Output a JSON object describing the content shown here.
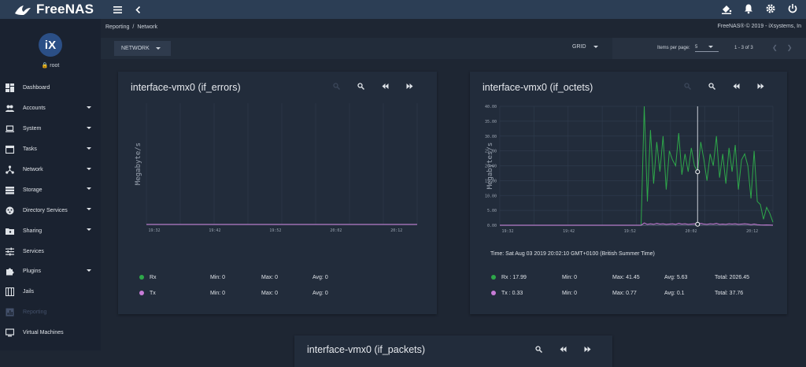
{
  "app": {
    "name": "FreeNAS"
  },
  "topbar": {
    "menu_icon": "hamburger-icon",
    "back_icon": "chevron-left-icon",
    "right_icons": [
      "theme-icon",
      "bell-icon",
      "gear-icon",
      "power-icon"
    ]
  },
  "sidebar": {
    "avatar_text": "iX",
    "user": "root",
    "items": [
      {
        "label": "Dashboard",
        "icon": "dashboard-icon",
        "caret": false
      },
      {
        "label": "Accounts",
        "icon": "accounts-icon",
        "caret": true
      },
      {
        "label": "System",
        "icon": "laptop-icon",
        "caret": true
      },
      {
        "label": "Tasks",
        "icon": "calendar-icon",
        "caret": true
      },
      {
        "label": "Network",
        "icon": "network-icon",
        "caret": true
      },
      {
        "label": "Storage",
        "icon": "storage-icon",
        "caret": true
      },
      {
        "label": "Directory Services",
        "icon": "directory-icon",
        "caret": true
      },
      {
        "label": "Sharing",
        "icon": "folder-share-icon",
        "caret": true
      },
      {
        "label": "Services",
        "icon": "tune-icon",
        "caret": false
      },
      {
        "label": "Plugins",
        "icon": "puzzle-icon",
        "caret": true
      },
      {
        "label": "Jails",
        "icon": "jail-icon",
        "caret": false
      },
      {
        "label": "Reporting",
        "icon": "chart-icon",
        "caret": false
      },
      {
        "label": "Virtual Machines",
        "icon": "monitor-icon",
        "caret": false
      }
    ]
  },
  "breadcrumb": {
    "parent": "Reporting",
    "separator": "/",
    "current": "Network"
  },
  "copyright": "FreeNAS® © 2019 - iXsystems, In",
  "toolbar": {
    "network_label": "NETWORK",
    "grid_label": "GRID",
    "items_per_page_label": "Items per page:",
    "items_per_page_value": "5",
    "range": "1 - 3 of 3"
  },
  "cards": [
    {
      "title": "interface-vmx0 (if_errors)",
      "legend": [
        {
          "name": "Rx",
          "color": "#2ea84a",
          "min": "Min: 0",
          "max": "Max: 0",
          "avg": "Avg: 0"
        },
        {
          "name": "Tx",
          "color": "#c77bd6",
          "min": "Min: 0",
          "max": "Max: 0",
          "avg": "Avg: 0"
        }
      ]
    },
    {
      "title": "interface-vmx0 (if_octets)",
      "time": "Time: Sat Aug 03 2019 20:02:10 GMT+0100 (British Summer Time)",
      "legend": [
        {
          "name": "Rx : 17.99",
          "color": "#2ea84a",
          "min": "Min: 0",
          "max": "Max: 41.45",
          "avg": "Avg: 5.63",
          "total": "Total: 2026.45"
        },
        {
          "name": "Tx : 0.33",
          "color": "#c77bd6",
          "min": "Min: 0",
          "max": "Max: 0.77",
          "avg": "Avg: 0.1",
          "total": "Total: 37.76"
        }
      ]
    },
    {
      "title": "interface-vmx0 (if_packets)"
    }
  ],
  "chart_data": [
    {
      "type": "line",
      "title": "interface-vmx0 (if_errors)",
      "ylabel": "Megabyte/s",
      "x_ticks": [
        "19:32",
        "19:42",
        "19:52",
        "20:02",
        "20:12"
      ],
      "series": [
        {
          "name": "Rx",
          "color": "#2ea84a",
          "values": [
            0,
            0,
            0,
            0,
            0,
            0,
            0
          ]
        },
        {
          "name": "Tx",
          "color": "#c77bd6",
          "values": [
            0,
            0,
            0,
            0,
            0,
            0,
            0
          ]
        }
      ]
    },
    {
      "type": "line",
      "title": "interface-vmx0 (if_octets)",
      "ylabel": "Megabytes/s",
      "ylim": [
        0,
        40
      ],
      "y_ticks": [
        "0.00",
        "5.00",
        "10.00",
        "15.00",
        "20.00",
        "25.00",
        "30.00",
        "35.00",
        "40.00"
      ],
      "x_ticks": [
        "19:32",
        "19:42",
        "19:52",
        "20:02",
        "20:12"
      ],
      "series": [
        {
          "name": "Rx",
          "color": "#2ea84a",
          "values": [
            0,
            0,
            0,
            0,
            0,
            0,
            0,
            0,
            0,
            0,
            0,
            0,
            0,
            0,
            0,
            0,
            0,
            0,
            0,
            0,
            0,
            0,
            0,
            0,
            0,
            0,
            0,
            0,
            0,
            0,
            0,
            0,
            0,
            0,
            0,
            0,
            0,
            0,
            0,
            0,
            0,
            0,
            0,
            0,
            0,
            0,
            41.45,
            8,
            32,
            14,
            28,
            18,
            30,
            12,
            25,
            22,
            20,
            31,
            17,
            24,
            18,
            26,
            20,
            17.99,
            28,
            22,
            15,
            24,
            20,
            30,
            16,
            24,
            14,
            26,
            18,
            27,
            12,
            22,
            24,
            20,
            9,
            25,
            8,
            7,
            2,
            6,
            4,
            1
          ]
        },
        {
          "name": "Tx",
          "color": "#c77bd6",
          "values": [
            0,
            0,
            0,
            0,
            0,
            0,
            0,
            0,
            0,
            0,
            0,
            0,
            0,
            0,
            0,
            0,
            0,
            0,
            0,
            0,
            0,
            0,
            0,
            0,
            0,
            0,
            0,
            0,
            0,
            0,
            0,
            0,
            0,
            0,
            0,
            0,
            0,
            0,
            0,
            0,
            0,
            0,
            0,
            0,
            0,
            0,
            0.77,
            0.3,
            0.5,
            0.33,
            0.6,
            0.4,
            0.5,
            0.3,
            0.4,
            0.5,
            0.3,
            0.6,
            0.4,
            0.5,
            0.3,
            0.4,
            0.5,
            0.33,
            0.6,
            0.4,
            0.3,
            0.5,
            0.4,
            0.6,
            0.3,
            0.4,
            0.3,
            0.5,
            0.4,
            0.5,
            0.3,
            0.4,
            0.5,
            0.4,
            0.2,
            0.4,
            0.2,
            0.1,
            0.05,
            0.1,
            0.05,
            0
          ]
        }
      ]
    }
  ]
}
